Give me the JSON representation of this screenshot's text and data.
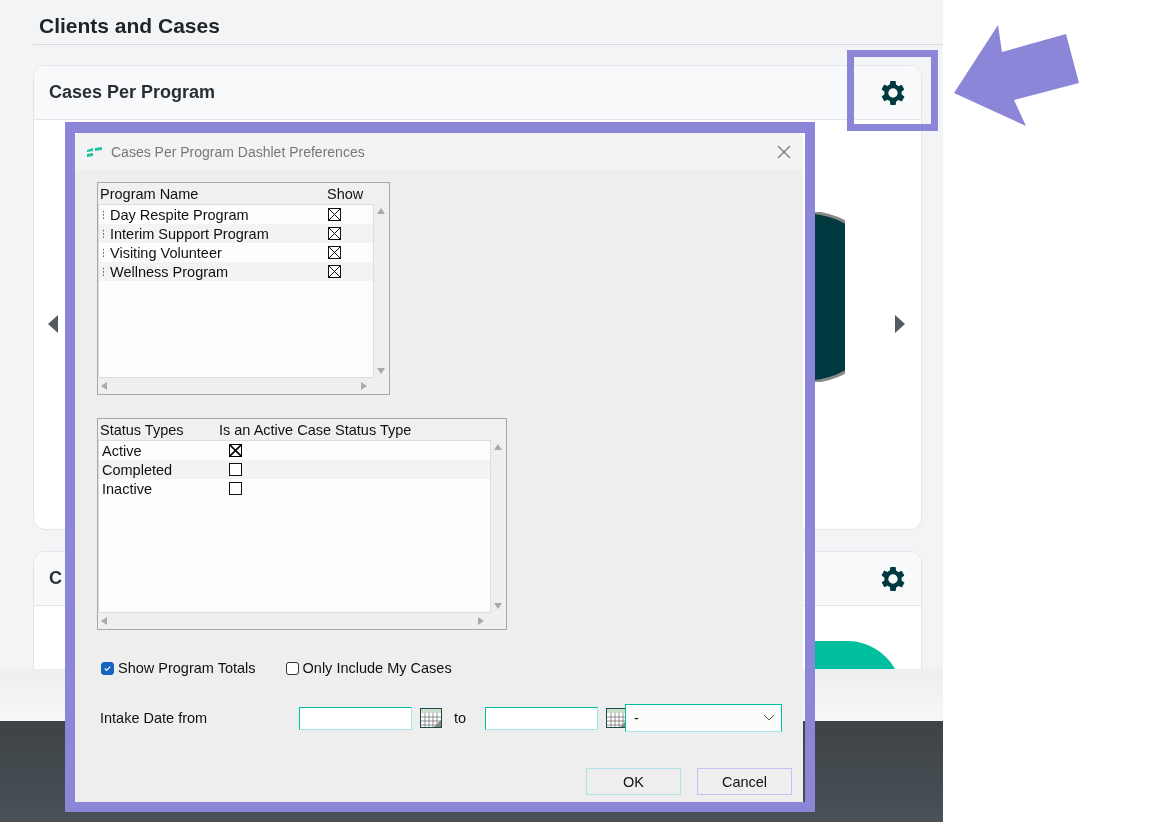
{
  "page": {
    "title": "Clients and Cases"
  },
  "cards": [
    {
      "title": "Cases Per Program"
    },
    {
      "title": "C"
    }
  ],
  "dialog": {
    "title": "Cases Per Program Dashlet Preferences",
    "programs": {
      "columns": [
        "Program Name",
        "Show"
      ],
      "rows": [
        {
          "name": "Day Respite Program",
          "show": true
        },
        {
          "name": "Interim Support Program",
          "show": true
        },
        {
          "name": "Visiting Volunteer",
          "show": true
        },
        {
          "name": "Wellness Program",
          "show": true
        }
      ]
    },
    "statuses": {
      "columns": [
        "Status Types",
        "Is an Active Case Status Type"
      ],
      "rows": [
        {
          "name": "Active",
          "active": true
        },
        {
          "name": "Completed",
          "active": false
        },
        {
          "name": "Inactive",
          "active": false
        }
      ]
    },
    "options": [
      {
        "label": "Show Program Totals",
        "checked": true
      },
      {
        "label": "Only Include My Cases",
        "checked": false
      }
    ],
    "intake": {
      "label": "Intake Date from",
      "to_label": "to",
      "range": "-"
    },
    "buttons": [
      "OK",
      "Cancel"
    ]
  }
}
